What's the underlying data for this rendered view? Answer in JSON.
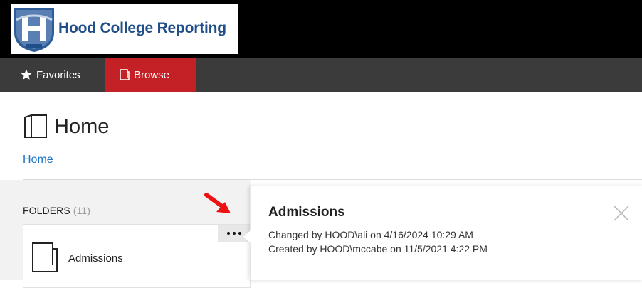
{
  "header": {
    "logo_text": "Hood College Reporting",
    "brand_color": "#1f4e89"
  },
  "nav": {
    "favorites_label": "Favorites",
    "browse_label": "Browse",
    "active_color": "#c42127"
  },
  "page": {
    "title": "Home",
    "breadcrumb": "Home"
  },
  "folders": {
    "header_label": "FOLDERS",
    "count_label": "(11)",
    "items": [
      {
        "name": "Admissions"
      }
    ]
  },
  "popup": {
    "title": "Admissions",
    "changed_line": "Changed by HOOD\\ali on 4/16/2024 10:29 AM",
    "created_line": "Created by HOOD\\mccabe on 11/5/2021 4:22 PM"
  },
  "icons": {
    "favorites": "star-icon",
    "browse": "folder-icon",
    "more": "ellipsis-icon",
    "close": "close-icon",
    "annotation": "red-arrow-icon"
  }
}
